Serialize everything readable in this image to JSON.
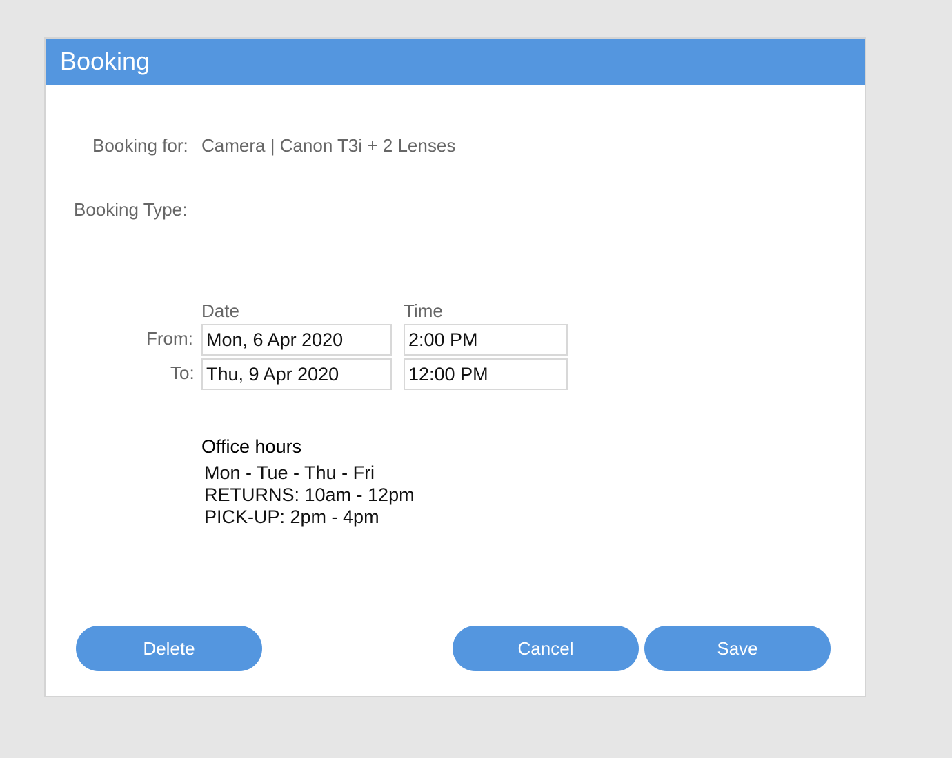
{
  "dialog": {
    "title": "Booking"
  },
  "booking_for": {
    "label": "Booking for:",
    "value": "Camera | Canon T3i + 2 Lenses"
  },
  "booking_type": {
    "label": "Booking Type:"
  },
  "schedule": {
    "date_header": "Date",
    "time_header": "Time",
    "from_label": "From:",
    "to_label": "To:",
    "from_date": "Mon, 6 Apr 2020",
    "from_time": "2:00 PM",
    "to_date": "Thu, 9 Apr 2020",
    "to_time": "12:00 PM"
  },
  "office_hours": {
    "title": "Office hours",
    "lines": [
      "Mon - Tue - Thu - Fri",
      "RETURNS: 10am - 12pm",
      "PICK-UP: 2pm - 4pm"
    ]
  },
  "buttons": {
    "delete": "Delete",
    "cancel": "Cancel",
    "save": "Save"
  },
  "colors": {
    "accent": "#5496df",
    "background": "#e6e6e6"
  }
}
